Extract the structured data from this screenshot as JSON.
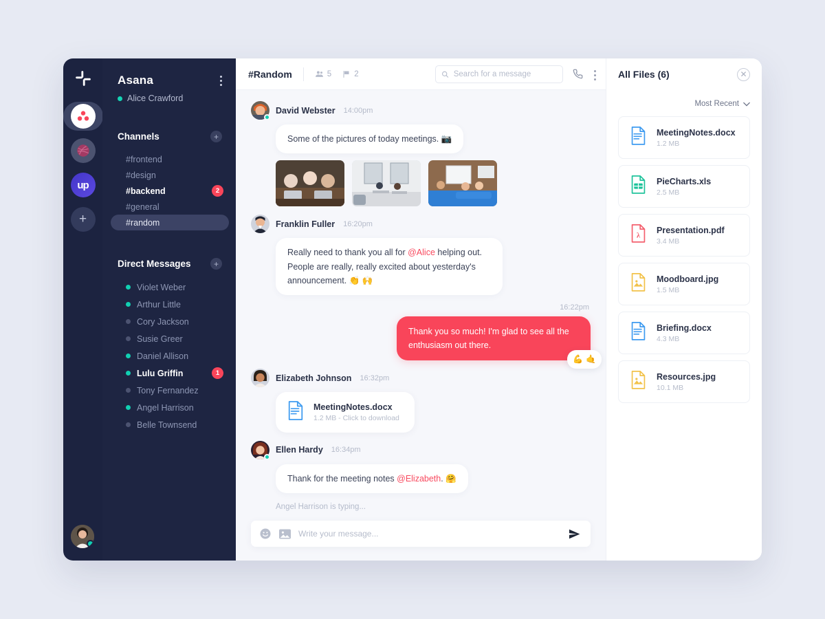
{
  "rail": {
    "logo": "slack-logo",
    "workspaces": [
      {
        "name": "asana-workspace",
        "label": "Asana",
        "active": true
      },
      {
        "name": "dribbble-workspace",
        "label": "Dribbble",
        "active": false
      },
      {
        "name": "upwork-workspace",
        "label": "up",
        "active": false
      }
    ],
    "add_label": "+",
    "user_avatar": "current-user-avatar"
  },
  "sidebar": {
    "workspace_title": "Asana",
    "user_name": "Alice Crawford",
    "channels_title": "Channels",
    "channels_add": "+",
    "channels": [
      {
        "label": "#frontend",
        "state": "read",
        "badge": ""
      },
      {
        "label": "#design",
        "state": "read",
        "badge": ""
      },
      {
        "label": "#backend",
        "state": "unread",
        "badge": "2"
      },
      {
        "label": "#general",
        "state": "read",
        "badge": ""
      },
      {
        "label": "#random",
        "state": "active",
        "badge": ""
      }
    ],
    "dm_title": "Direct Messages",
    "dm_add": "+",
    "dms": [
      {
        "label": "Violet Weber",
        "online": true,
        "bold": false,
        "badge": ""
      },
      {
        "label": "Arthur Little",
        "online": true,
        "bold": false,
        "badge": ""
      },
      {
        "label": "Cory Jackson",
        "online": false,
        "bold": false,
        "badge": ""
      },
      {
        "label": "Susie Greer",
        "online": false,
        "bold": false,
        "badge": ""
      },
      {
        "label": "Daniel Allison",
        "online": true,
        "bold": false,
        "badge": ""
      },
      {
        "label": "Lulu Griffin",
        "online": true,
        "bold": true,
        "badge": "1"
      },
      {
        "label": "Tony Fernandez",
        "online": false,
        "bold": false,
        "badge": ""
      },
      {
        "label": "Angel Harrison",
        "online": true,
        "bold": false,
        "badge": ""
      },
      {
        "label": "Belle Townsend",
        "online": false,
        "bold": false,
        "badge": ""
      }
    ]
  },
  "chat_header": {
    "channel": "#Random",
    "members_count": "5",
    "pins_count": "2",
    "search_placeholder": "Search for a message",
    "call_icon": "phone-icon",
    "more_icon": "kebab-menu-icon"
  },
  "messages": [
    {
      "type": "text",
      "sender": "David Webster",
      "time": "14:00pm",
      "online": true,
      "text_before": "Some of the pictures of today meetings. ",
      "emoji": "📷",
      "thumbs": [
        "meeting-photo-1",
        "meeting-photo-2",
        "meeting-photo-3"
      ]
    },
    {
      "type": "mention",
      "sender": "Franklin Fuller",
      "time": "16:20pm",
      "online": false,
      "part1": "Really need to thank you all for ",
      "mention": "@Alice",
      "part2": " helping out. People are really, really excited about yesterday's announcement. ",
      "emoji": "👏 🙌"
    },
    {
      "type": "outgoing",
      "time": "16:22pm",
      "text": "Thank you so much! I'm glad to see all the enthusiasm out there.",
      "reactions": [
        "💪",
        "🤙"
      ]
    },
    {
      "type": "file",
      "sender": "Elizabeth Johnson",
      "time": "16:32pm",
      "online": false,
      "file_name": "MeetingNotes.docx",
      "file_meta": "1.2 MB - Click to download",
      "file_icon": "docx-file-icon"
    },
    {
      "type": "mention",
      "sender": "Ellen Hardy",
      "time": "16:34pm",
      "online": true,
      "part1": "Thank for the meeting notes ",
      "mention": "@Elizabeth",
      "part2": ". ",
      "emoji": "🤗"
    }
  ],
  "typing_status": "Angel Harrison is typing...",
  "composer": {
    "emoji_icon": "emoji-icon",
    "image_icon": "image-attach-icon",
    "placeholder": "Write your message...",
    "value": "",
    "send_icon": "send-icon"
  },
  "files_panel": {
    "title": "All Files (6)",
    "close_icon": "close-icon",
    "sort_label": "Most Recent",
    "files": [
      {
        "name": "MeetingNotes.docx",
        "size": "1.2 MB",
        "kind": "doc",
        "color": "#3e9bf0"
      },
      {
        "name": "PieCharts.xls",
        "size": "2.5 MB",
        "kind": "xls",
        "color": "#1fc39b"
      },
      {
        "name": "Presentation.pdf",
        "size": "3.4 MB",
        "kind": "pdf",
        "color": "#f4606e"
      },
      {
        "name": "Moodboard.jpg",
        "size": "1.5 MB",
        "kind": "img",
        "color": "#f2c24a"
      },
      {
        "name": "Briefing.docx",
        "size": "4.3 MB",
        "kind": "doc",
        "color": "#3e9bf0"
      },
      {
        "name": "Resources.jpg",
        "size": "10.1 MB",
        "kind": "img",
        "color": "#f2c24a"
      }
    ]
  },
  "colors": {
    "page_bg": "#e7eaf3",
    "sidebar_bg": "#1e2542",
    "rail_bg": "#1c2340",
    "accent_red": "#f9455a",
    "online_green": "#11cfb2",
    "chat_bg": "#f6f7fb"
  }
}
